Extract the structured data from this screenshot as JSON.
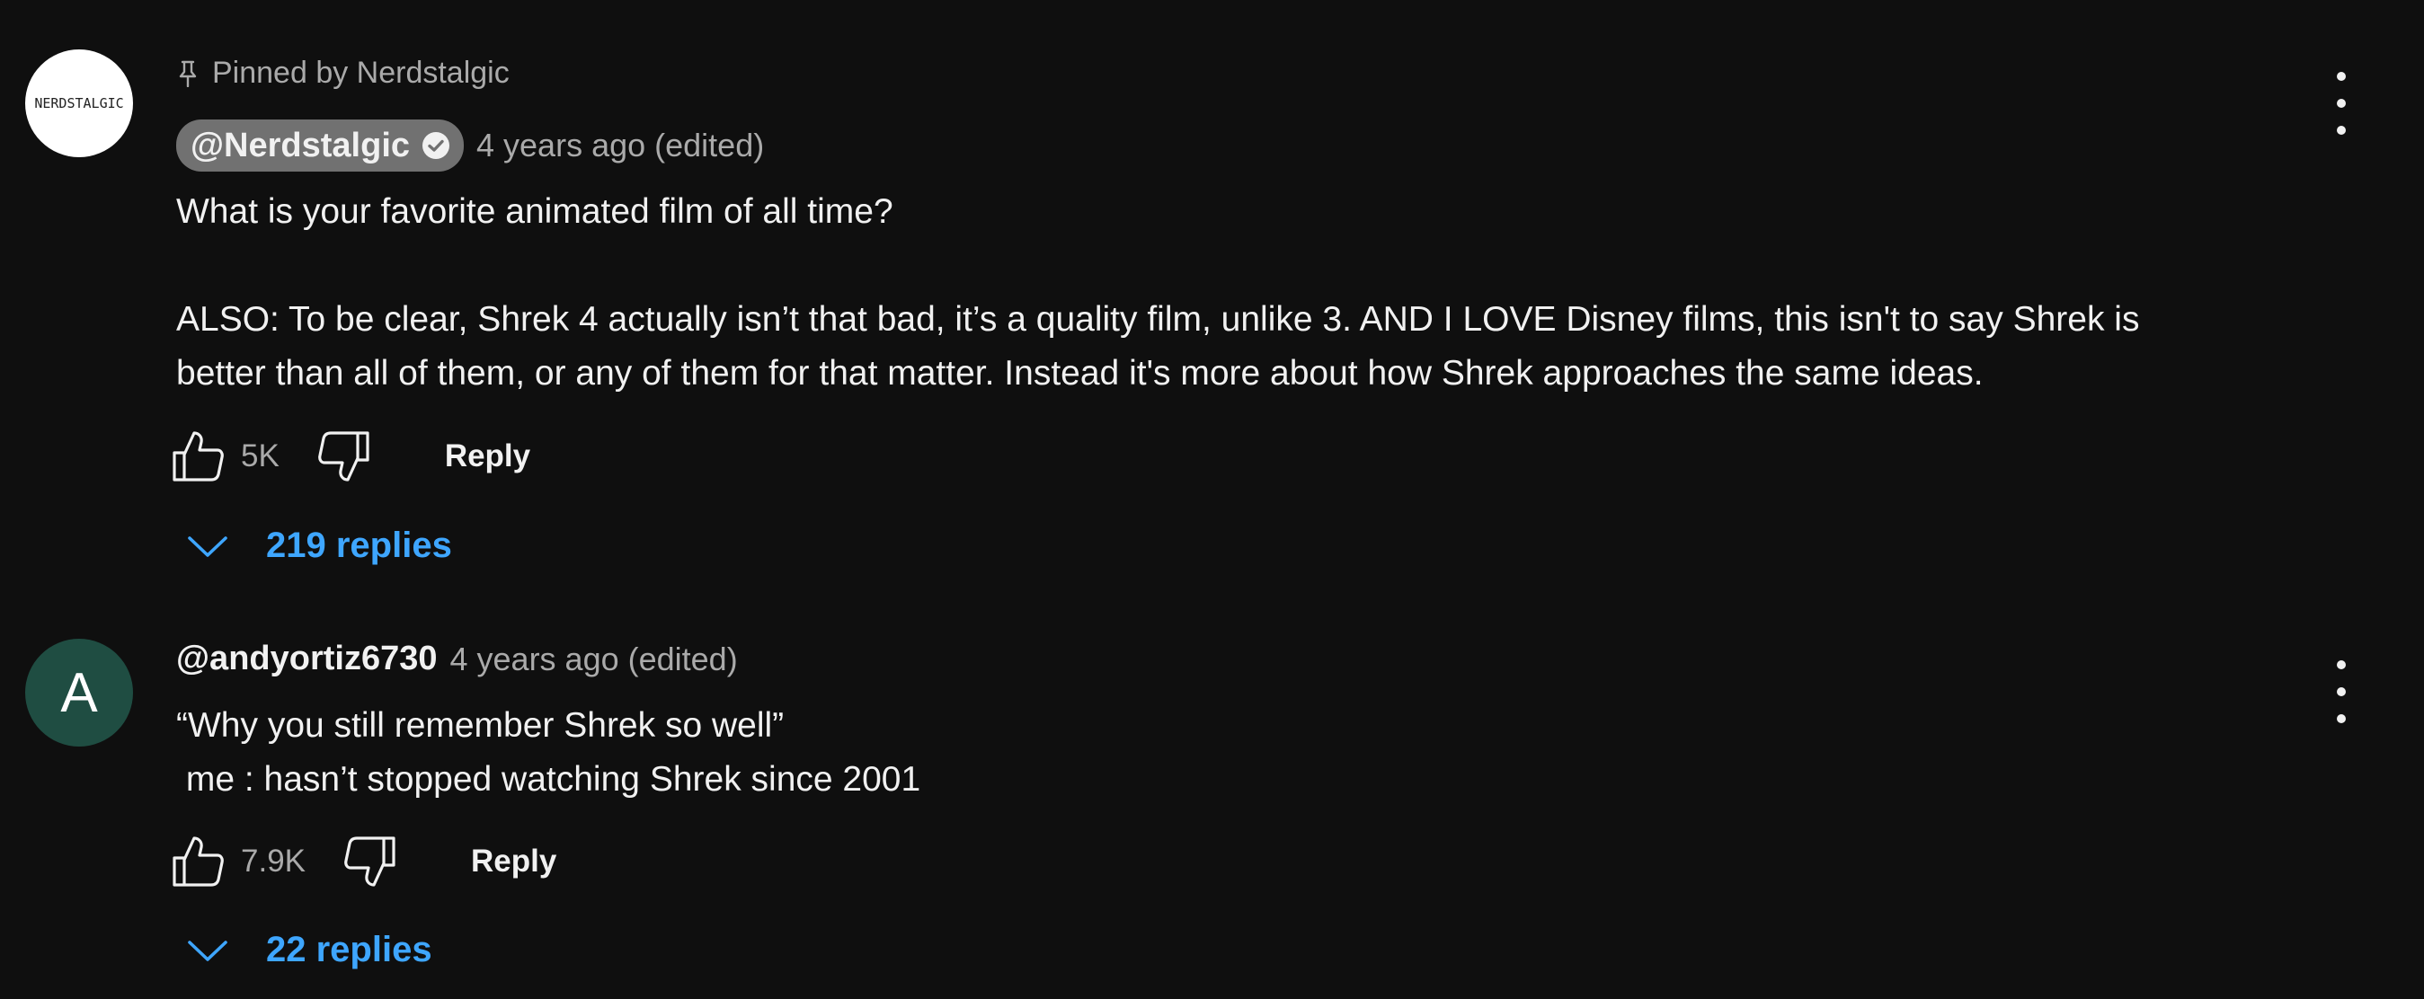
{
  "comments": [
    {
      "pinned_label": "Pinned by Nerdstalgic",
      "avatar_text": "NERDSTALGIC",
      "author": "@Nerdstalgic",
      "verified": true,
      "timestamp": "4 years ago (edited)",
      "text": "What is your favorite animated film of all time?\n\nALSO: To be clear, Shrek 4 actually isn’t that bad, it’s a quality film, unlike 3. AND I LOVE Disney films, this isn't to say Shrek is\nbetter than all of them, or any of them for that matter. Instead it's more about how Shrek approaches the same ideas.",
      "likes": "5K",
      "reply_label": "Reply",
      "replies_label": "219 replies"
    },
    {
      "avatar_text": "A",
      "author": "@andyortiz6730",
      "timestamp": "4 years ago (edited)",
      "text": "“Why you still remember Shrek so well”\n me : hasn’t stopped watching Shrek since 2001",
      "likes": "7.9K",
      "reply_label": "Reply",
      "replies_label": "22 replies"
    }
  ],
  "colors": {
    "background": "#0f0f0f",
    "text_primary": "#f1f1f1",
    "text_secondary": "#aaaaaa",
    "link_blue": "#3ea6ff",
    "author_chip": "#717171",
    "avatar_2": "#1f4d42"
  },
  "icons": {
    "pin": "pin-icon",
    "verified": "verified-check-icon",
    "like": "thumbs-up-icon",
    "dislike": "thumbs-down-icon",
    "expand": "chevron-down-icon",
    "menu": "more-vert-icon"
  }
}
